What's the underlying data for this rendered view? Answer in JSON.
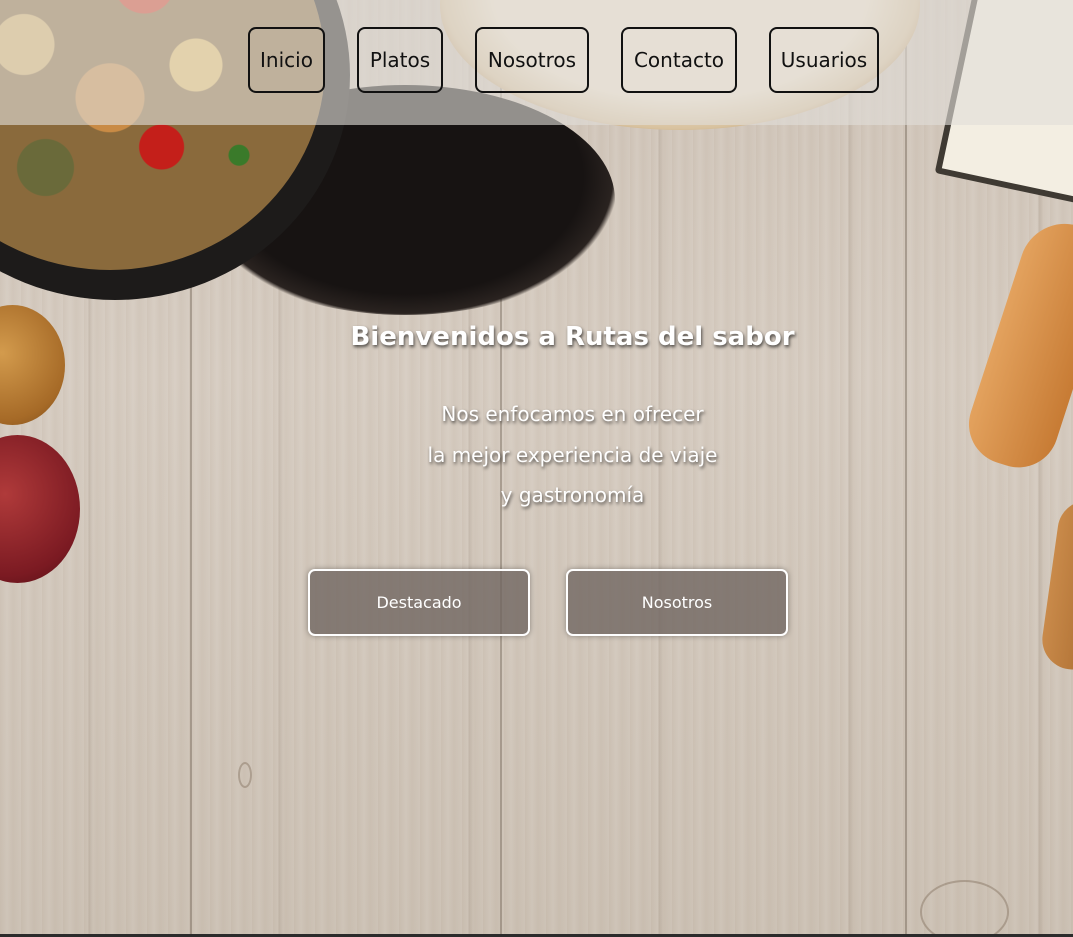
{
  "nav": {
    "items": [
      {
        "label": "Inicio"
      },
      {
        "label": "Platos"
      },
      {
        "label": "Nosotros"
      },
      {
        "label": "Contacto"
      },
      {
        "label": "Usuarios"
      }
    ]
  },
  "hero": {
    "title": "Bienvenidos a Rutas del sabor",
    "lines": [
      "Nos enfocamos en ofrecer",
      "la mejor experiencia de viaje",
      "y gastronomía"
    ],
    "buttons": [
      {
        "label": "Destacado"
      },
      {
        "label": "Nosotros"
      }
    ]
  },
  "colors": {
    "nav_border": "#111111",
    "hero_text": "#ffffff",
    "hero_button_bg": "#6e645f"
  }
}
